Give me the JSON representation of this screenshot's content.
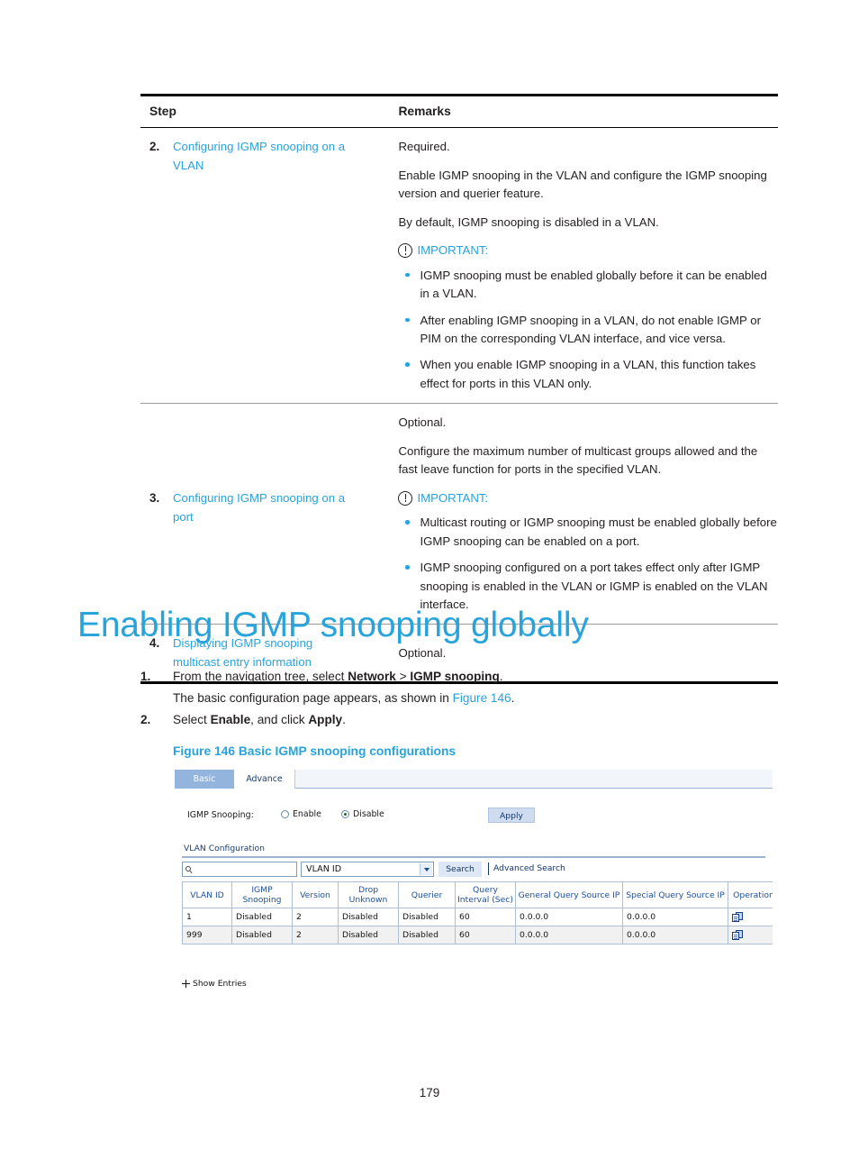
{
  "procedure_table": {
    "headers": {
      "step": "Step",
      "remarks": "Remarks"
    },
    "rows": [
      {
        "number": "2.",
        "step_link": "Configuring IGMP snooping on a VLAN",
        "remarks_paragraphs": [
          "Required.",
          "Enable IGMP snooping in the VLAN and configure the IGMP snooping version and querier feature.",
          "By default, IGMP snooping is disabled in a VLAN."
        ],
        "important_label": "IMPORTANT:",
        "important_bullets": [
          "IGMP snooping must be enabled globally before it can be enabled in a VLAN.",
          "After enabling IGMP snooping in a VLAN, do not enable IGMP or PIM on the corresponding VLAN interface, and vice versa.",
          "When you enable IGMP snooping in a VLAN, this function takes effect for ports in this VLAN only."
        ]
      },
      {
        "number": "3.",
        "step_link": "Configuring IGMP snooping on a port",
        "remarks_paragraphs": [
          "Optional.",
          "Configure the maximum number of multicast groups allowed and the fast leave function for ports in the specified VLAN."
        ],
        "important_label": "IMPORTANT:",
        "important_bullets": [
          "Multicast routing or IGMP snooping must be enabled globally before IGMP snooping can be enabled on a port.",
          "IGMP snooping configured on a port takes effect only after IGMP snooping is enabled in the VLAN or IGMP is enabled on the VLAN interface."
        ]
      },
      {
        "number": "4.",
        "step_link": "Displaying IGMP snooping multicast entry information",
        "remarks_paragraphs": [
          "Optional."
        ],
        "important_label": "",
        "important_bullets": []
      }
    ]
  },
  "heading": "Enabling IGMP snooping globally",
  "steps": [
    {
      "number": "1.",
      "line_prefix": "From the navigation tree, select ",
      "bold_1": "Network",
      "mid": " > ",
      "bold_2": "IGMP snooping",
      "line_suffix": ".",
      "sub_prefix": "The basic configuration page appears, as shown in ",
      "sub_link": "Figure 146",
      "sub_suffix": "."
    },
    {
      "number": "2.",
      "line_prefix": "Select ",
      "bold_1": "Enable",
      "mid": ", and click ",
      "bold_2": "Apply",
      "line_suffix": "."
    }
  ],
  "figure": {
    "caption": "Figure 146 Basic IGMP snooping configurations",
    "tabs": [
      {
        "label": "Basic",
        "active": true
      },
      {
        "label": "Advance",
        "active": false
      }
    ],
    "snooping_row": {
      "label": "IGMP Snooping:",
      "enable_label": "Enable",
      "disable_label": "Disable",
      "selected": "Disable",
      "apply_button": "Apply"
    },
    "vlan_section_title": "VLAN Configuration",
    "search": {
      "input_value": "",
      "select_value": "VLAN ID",
      "search_button": "Search",
      "advanced_search": "Advanced Search"
    },
    "table": {
      "headers": [
        "VLAN ID",
        "IGMP Snooping",
        "Version",
        "Drop Unknown",
        "Querier",
        "Query Interval (Sec)",
        "General Query Source IP",
        "Special Query Source IP",
        "Operation"
      ],
      "rows": [
        {
          "vlan_id": "1",
          "igmp_snooping": "Disabled",
          "version": "2",
          "drop_unknown": "Disabled",
          "querier": "Disabled",
          "query_interval": "60",
          "general_query_source_ip": "0.0.0.0",
          "special_query_source_ip": "0.0.0.0"
        },
        {
          "vlan_id": "999",
          "igmp_snooping": "Disabled",
          "version": "2",
          "drop_unknown": "Disabled",
          "querier": "Disabled",
          "query_interval": "60",
          "general_query_source_ip": "0.0.0.0",
          "special_query_source_ip": "0.0.0.0"
        }
      ]
    },
    "show_entries": "Show Entries"
  },
  "page_number": "179",
  "colors": {
    "accent_blue": "#28a3dc",
    "ui_header_blue": "#1c4f9c",
    "tab_active_bg": "#93b4dd"
  }
}
